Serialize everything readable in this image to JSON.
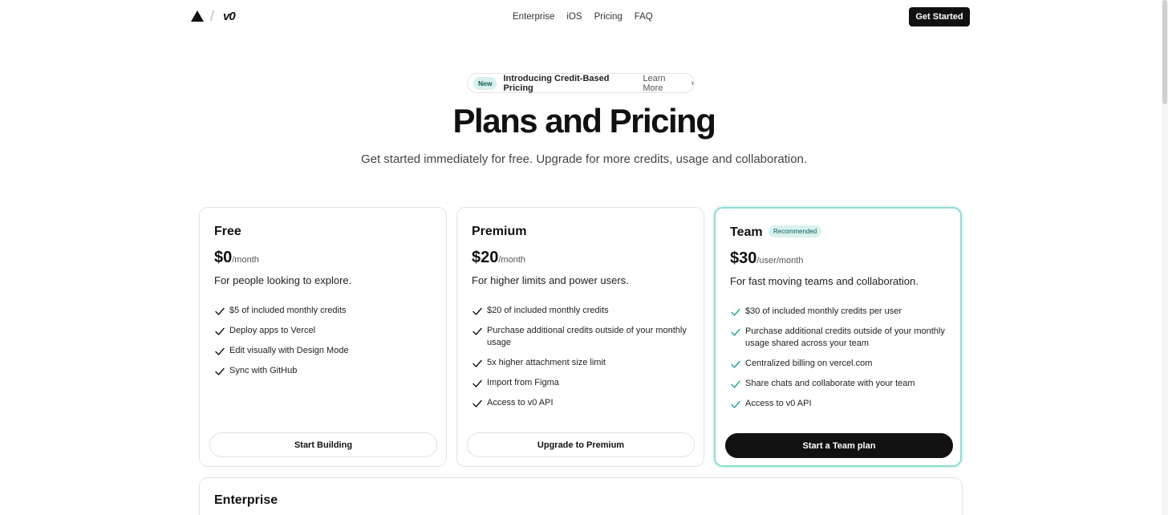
{
  "header": {
    "logo_alt": "Vercel",
    "brand": "v0",
    "nav": [
      "Enterprise",
      "iOS",
      "Pricing",
      "FAQ"
    ],
    "cta": "Get Started"
  },
  "announcement": {
    "badge": "New",
    "text": "Introducing Credit-Based Pricing",
    "link": "Learn More"
  },
  "hero": {
    "title": "Plans and Pricing",
    "subtitle": "Get started immediately for free. Upgrade for more credits, usage and collaboration."
  },
  "plans": [
    {
      "name": "Free",
      "price": "$0",
      "period": "/month",
      "description": "For people looking to explore.",
      "features": [
        "$5 of included monthly credits",
        "Deploy apps to Vercel",
        "Edit visually with Design Mode",
        "Sync with GitHub"
      ],
      "button": "Start Building"
    },
    {
      "name": "Premium",
      "price": "$20",
      "period": "/month",
      "description": "For higher limits and power users.",
      "features": [
        "$20 of included monthly credits",
        "Purchase additional credits outside of your monthly usage",
        "5x higher attachment size limit",
        "Import from Figma",
        "Access to v0 API"
      ],
      "button": "Upgrade to Premium"
    },
    {
      "name": "Team",
      "badge": "Recommended",
      "price": "$30",
      "period": "/user/month",
      "description": "For fast moving teams and collaboration.",
      "features": [
        "$30 of included monthly credits per user",
        "Purchase additional credits outside of your monthly usage shared across your team",
        "Centralized billing on vercel.com",
        "Share chats and collaborate with your team",
        "Access to v0 API"
      ],
      "button": "Start a Team plan"
    }
  ],
  "enterprise": {
    "name": "Enterprise"
  },
  "colors": {
    "accent": "#8fdcd4",
    "badge_bg": "#d7f2ee",
    "team_check": "#1aa896",
    "dark": "#111111"
  }
}
